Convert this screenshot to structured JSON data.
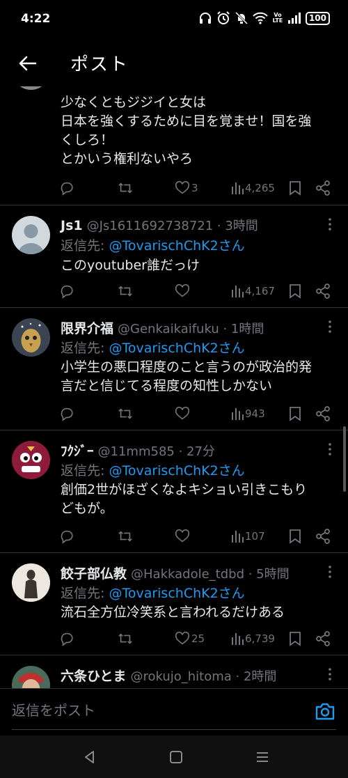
{
  "status_bar": {
    "time": "4:22",
    "battery": "100",
    "network_label": "Vo LTE"
  },
  "header": {
    "title": "ポスト"
  },
  "posts": [
    {
      "body": [
        "少なくともジジイと女は",
        "日本を強くするために目を覚ませ！国を強",
        "くしろ！",
        "とかいう権利ないやろ"
      ],
      "likes": "3",
      "views": "4,265"
    },
    {
      "author": "Js1",
      "handle": "@Js1611692738721 · 3時間",
      "reply_prefix": "返信先: ",
      "reply_to": "@TovarischChK2さん",
      "body": [
        "このyoutuber誰だっけ"
      ],
      "likes": "",
      "views": "4,167"
    },
    {
      "author": "限界介福",
      "handle": "@Genkaikaifuku · 1時間",
      "reply_prefix": "返信先: ",
      "reply_to": "@TovarischChK2さん",
      "body": [
        "小学生の悪口程度のこと言うのが政治的発",
        "言だと信じてる程度の知性しかない"
      ],
      "likes": "",
      "views": "943"
    },
    {
      "author": "ﾌｸｼﾞｰ",
      "handle": "@11mm585 · 27分",
      "reply_prefix": "返信先: ",
      "reply_to": "@TovarischChK2さん",
      "body": [
        "創価2世がほざくなよキショい引きこもり",
        "どもが。"
      ],
      "likes": "",
      "views": "107"
    },
    {
      "author": "餃子部仏教",
      "handle": "@Hakkadole_tdbd · 5時間",
      "reply_prefix": "返信先: ",
      "reply_to": "@TovarischChK2さん",
      "body": [
        "流石全方位冷笑系と言われるだけある"
      ],
      "likes": "25",
      "views": "6,739"
    },
    {
      "author": "六条ひとま",
      "handle": "@rokujo_hitoma · 2時間"
    }
  ],
  "reply_bar": {
    "placeholder": "返信をポスト"
  },
  "icons": {
    "reply": "reply-icon",
    "repost": "repost-icon",
    "like": "like-icon",
    "views": "views-icon",
    "bookmark": "bookmark-icon",
    "share": "share-icon",
    "camera": "camera-icon",
    "back": "back-arrow-icon"
  },
  "colors": {
    "background": "#000000",
    "text": "#e7e9ea",
    "muted": "#71767b",
    "link": "#1d9bf0"
  }
}
